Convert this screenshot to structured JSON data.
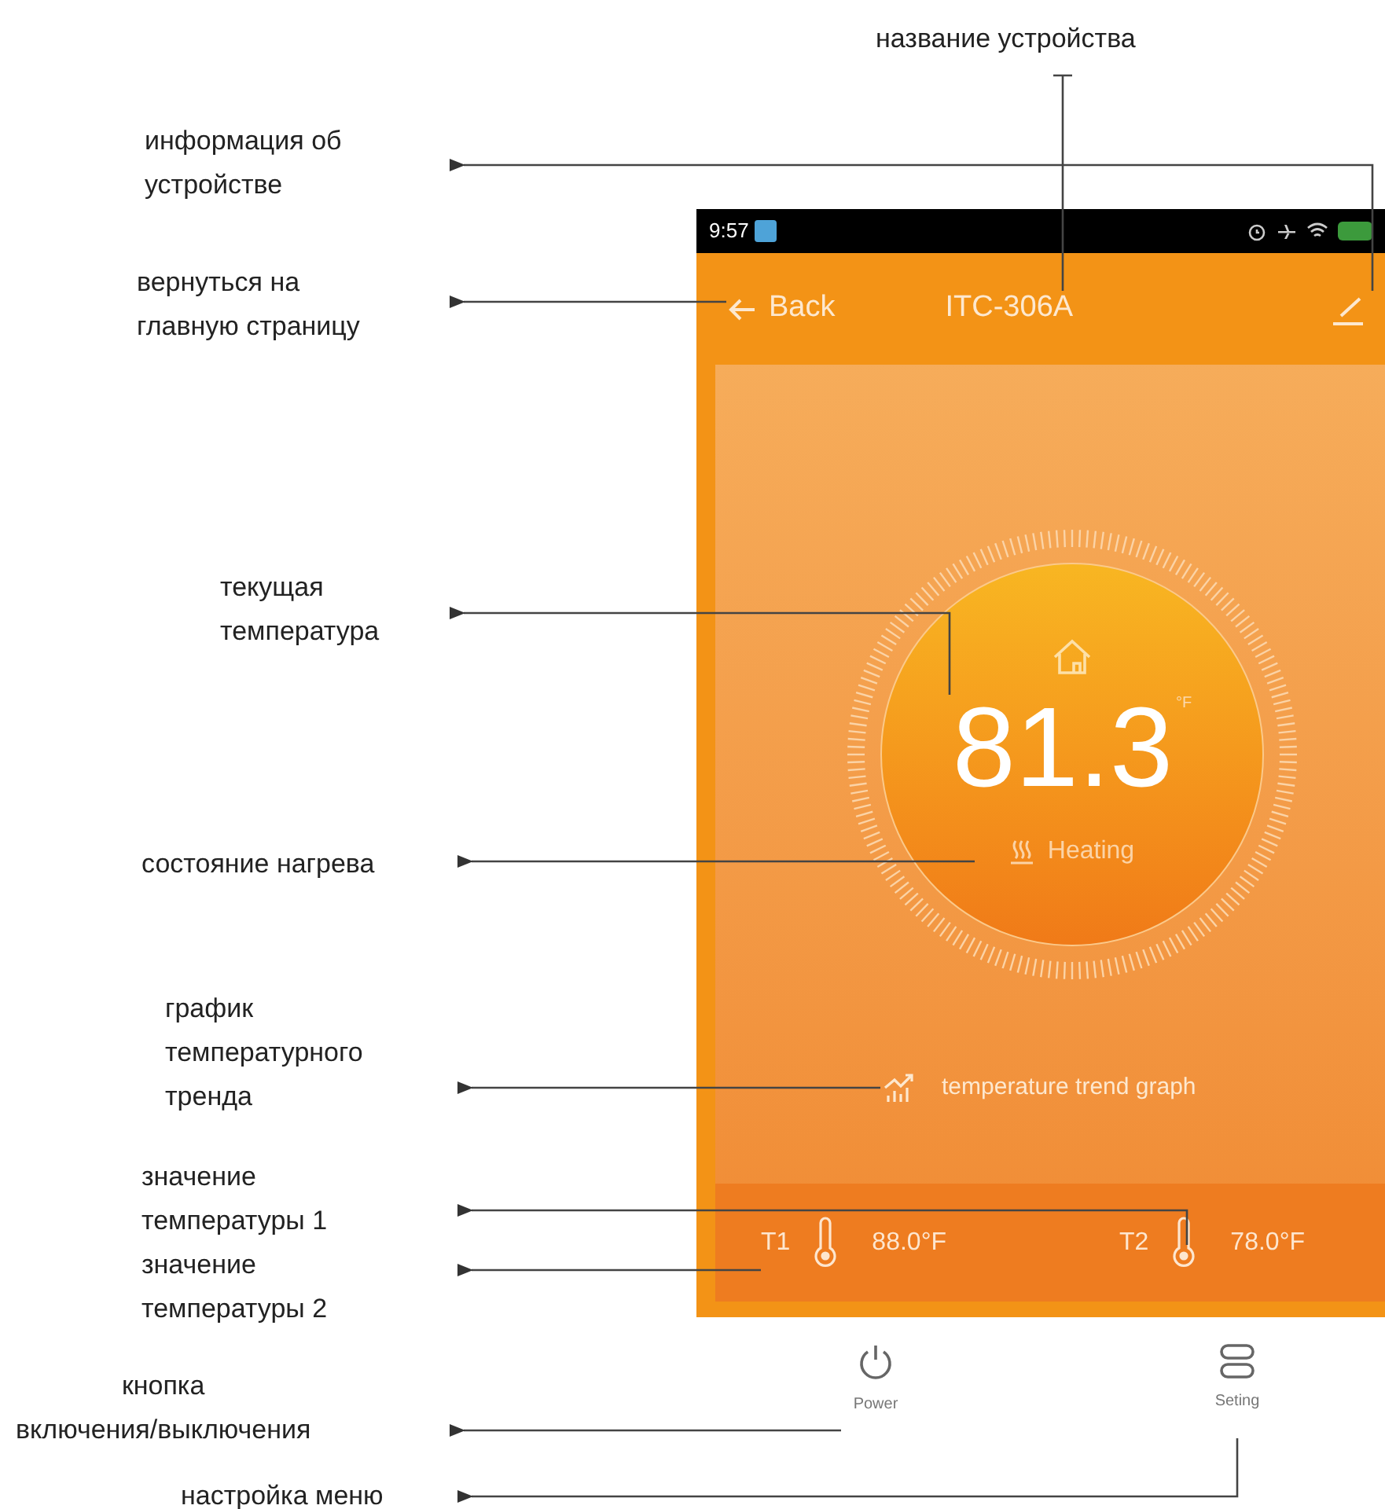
{
  "annotation_title": "название устройства",
  "callouts": [
    {
      "text": "информация об\nустройстве"
    },
    {
      "text": "вернуться на\nглавную страницу"
    },
    {
      "text": "текущая\nтемпература"
    },
    {
      "text": "состояние нагрева"
    },
    {
      "text": "график\nтемпературного\nтренда"
    },
    {
      "text": "значение\nтемпературы 1"
    },
    {
      "text": "значение\nтемпературы 2"
    },
    {
      "text": "кнопка\nвключения/выключения"
    },
    {
      "text": "настройка меню"
    }
  ],
  "status_bar": {
    "time": "9:57"
  },
  "header": {
    "back": "Back",
    "title": "ITC-306A"
  },
  "thermostat": {
    "temperature": "81.3",
    "unit": "°F",
    "status": "Heating",
    "trend_link": "temperature trend graph"
  },
  "sensors": [
    {
      "label": "T1",
      "value": "88.0°F"
    },
    {
      "label": "T2",
      "value": "78.0°F"
    }
  ],
  "nav": [
    {
      "kind": "power",
      "label": "Power"
    },
    {
      "kind": "settings",
      "label": "Seting"
    }
  ]
}
